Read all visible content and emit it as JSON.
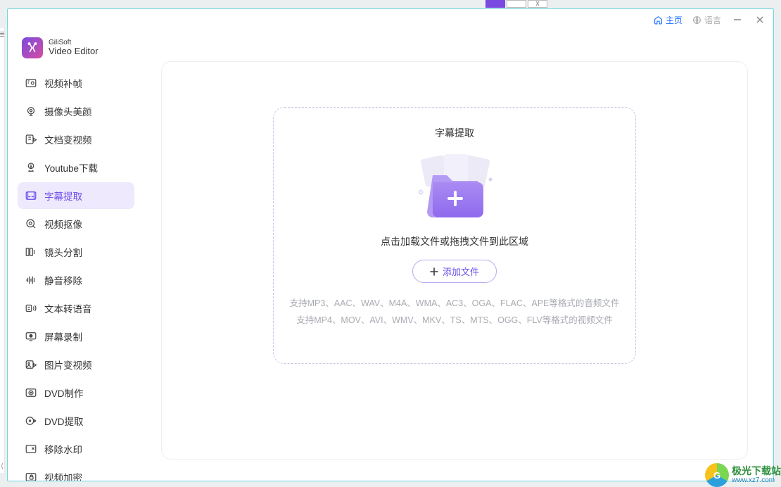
{
  "app": {
    "brand_line1": "GiliSoft",
    "brand_line2": "Video Editor"
  },
  "titlebar": {
    "home_label": "主页",
    "language_label": "语言"
  },
  "sidebar": {
    "items": [
      {
        "id": "video-interpolation",
        "label": "视频补帧",
        "active": false
      },
      {
        "id": "camera-beauty",
        "label": "摄像头美颜",
        "active": false
      },
      {
        "id": "doc-to-video",
        "label": "文档变视频",
        "active": false
      },
      {
        "id": "youtube-download",
        "label": "Youtube下载",
        "active": false
      },
      {
        "id": "subtitle-extract",
        "label": "字幕提取",
        "active": true
      },
      {
        "id": "video-cutout",
        "label": "视频抠像",
        "active": false
      },
      {
        "id": "lens-split",
        "label": "镜头分割",
        "active": false
      },
      {
        "id": "silence-remove",
        "label": "静音移除",
        "active": false
      },
      {
        "id": "tts",
        "label": "文本转语音",
        "active": false
      },
      {
        "id": "screen-record",
        "label": "屏幕录制",
        "active": false
      },
      {
        "id": "image-to-video",
        "label": "图片变视频",
        "active": false
      },
      {
        "id": "dvd-make",
        "label": "DVD制作",
        "active": false
      },
      {
        "id": "dvd-extract",
        "label": "DVD提取",
        "active": false
      },
      {
        "id": "remove-watermark",
        "label": "移除水印",
        "active": false
      },
      {
        "id": "video-encrypt",
        "label": "视频加密",
        "active": false
      }
    ]
  },
  "main": {
    "panel_title": "字幕提取",
    "drop_hint": "点击加载文件或拖拽文件到此区域",
    "add_button_label": "添加文件",
    "formats_line1": "支持MP3、AAC、WAV、M4A、WMA、AC3、OGA、FLAC、APE等格式的音频文件",
    "formats_line2": "支持MP4、MOV、AVI、WMV、MKV、TS、MTS、OGG、FLV等格式的视频文件"
  },
  "watermark": {
    "name": "极光下载站",
    "url": "www.xz7.com"
  }
}
